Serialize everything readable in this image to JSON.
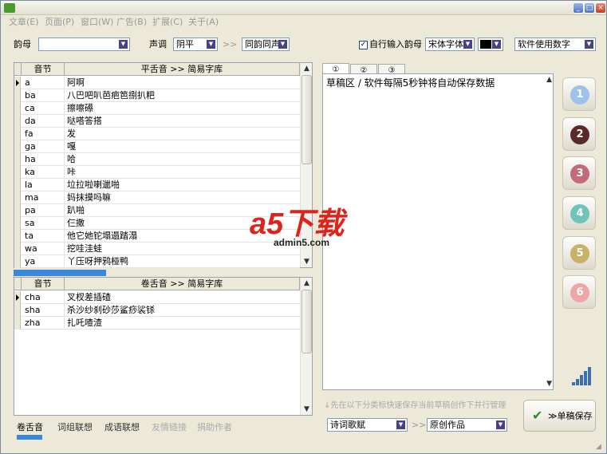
{
  "window": {
    "minimize": "_",
    "maximize": "□",
    "close": "×"
  },
  "menu": [
    "文章(E)",
    "页面(P)",
    "窗口(W)",
    "广告(B)",
    "扩展(C)",
    "关于(A)"
  ],
  "toolbar": {
    "shengmu_label": "韵母",
    "shengmu_value": "",
    "shengdiao_label": "声调",
    "shengdiao_value": "阴平",
    "arrow": ">>",
    "tongyun_value": "同韵同声",
    "auto_input_label": "自行输入韵母",
    "font_value": "宋体字体",
    "color_value": "#000000",
    "keyboard_value": "软件使用数字"
  },
  "grid1": {
    "headers": [
      "音节",
      "平舌音 >> 简易字库"
    ],
    "rows": [
      {
        "syllable": "a",
        "chars": "阿啊"
      },
      {
        "syllable": "ba",
        "chars": "八巴吧叭芭疤笆捌扒粑"
      },
      {
        "syllable": "ca",
        "chars": "擦嚓礤"
      },
      {
        "syllable": "da",
        "chars": "哒嗒答搭"
      },
      {
        "syllable": "fa",
        "chars": "发"
      },
      {
        "syllable": "ga",
        "chars": "嘎"
      },
      {
        "syllable": "ha",
        "chars": "哈"
      },
      {
        "syllable": "ka",
        "chars": "咔"
      },
      {
        "syllable": "la",
        "chars": "垃拉啦喇邋啪"
      },
      {
        "syllable": "ma",
        "chars": "妈抹摸吗嘛"
      },
      {
        "syllable": "pa",
        "chars": "趴啪"
      },
      {
        "syllable": "sa",
        "chars": "仨撒"
      },
      {
        "syllable": "ta",
        "chars": "他它她铊塌遢踏溻"
      },
      {
        "syllable": "wa",
        "chars": "挖哇洼蛙"
      },
      {
        "syllable": "ya",
        "chars": "丫压呀押鸦桠鸭"
      }
    ]
  },
  "grid2": {
    "headers": [
      "音节",
      "卷舌音 >> 简易字库"
    ],
    "rows": [
      {
        "syllable": "cha",
        "chars": "叉杈差插碴"
      },
      {
        "syllable": "sha",
        "chars": "杀沙纱刹砂莎鲨痧裟铩"
      },
      {
        "syllable": "zha",
        "chars": "扎吒喳渣"
      }
    ]
  },
  "tabs": [
    "①",
    "②",
    "③"
  ],
  "editor_text": "草稿区 / 软件每隔5秒钟将自动保存数据",
  "hint": "↓先在以下分类标快速保存当前草稿创作下并行管理",
  "bottom_select1": "诗词歌赋",
  "bottom_select2": "原创作品",
  "save_button": "≫单稿保存",
  "bottom_tabs": [
    "卷舌音",
    "词组联想",
    "成语联想",
    "友情链接",
    "捐助作者"
  ],
  "number_buttons": [
    "1",
    "2",
    "3",
    "4",
    "5",
    "6"
  ],
  "logo": {
    "main": "a5下载",
    "sub": "admin5.com"
  }
}
